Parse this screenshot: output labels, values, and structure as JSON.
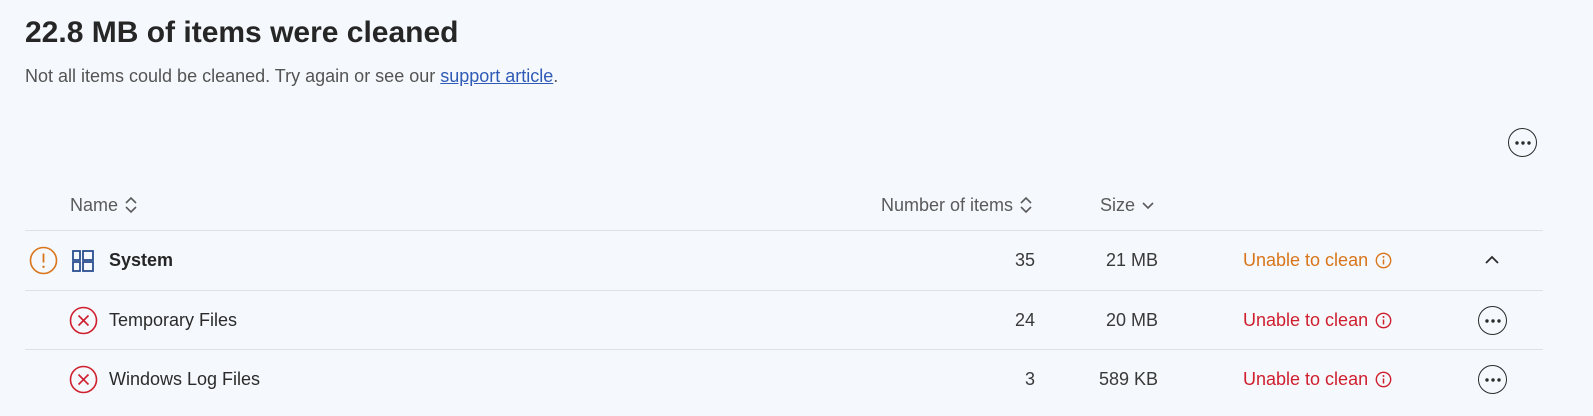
{
  "header": {
    "title": "22.8 MB of items were cleaned",
    "subtitle_prefix": "Not all items could be cleaned. Try again or see our ",
    "subtitle_link": "support article",
    "subtitle_suffix": "."
  },
  "table": {
    "columns": {
      "name": "Name",
      "count": "Number of items",
      "size": "Size"
    },
    "group": {
      "name": "System",
      "count": "35",
      "size": "21 MB",
      "status": "Unable to clean"
    },
    "rows": [
      {
        "name": "Temporary Files",
        "count": "24",
        "size": "20 MB",
        "status": "Unable to clean"
      },
      {
        "name": "Windows Log Files",
        "count": "3",
        "size": "589 KB",
        "status": "Unable to clean"
      }
    ]
  },
  "colors": {
    "warning": "#d9751a",
    "error": "#cf1f2e",
    "link": "#2f5bb7",
    "system_icon": "#2b4f8f"
  },
  "icons": {
    "more": "more-horizontal-icon",
    "warning": "warning-circle-icon",
    "error": "error-x-circle-icon",
    "windows": "windows-system-icon",
    "info": "info-icon",
    "sort": "sort-icon",
    "collapse": "chevron-up-icon"
  }
}
